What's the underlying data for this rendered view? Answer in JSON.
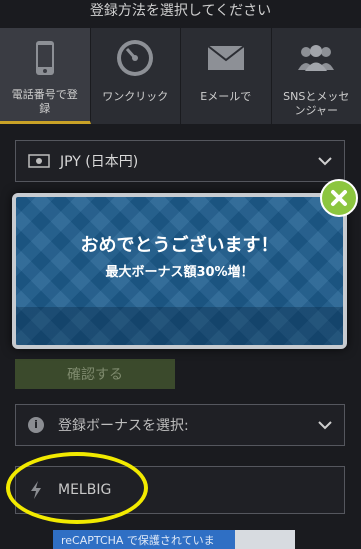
{
  "header": {
    "title": "登録方法を選択してください"
  },
  "tabs": [
    {
      "label": "電話番号で登\n録",
      "icon": "phone-icon",
      "active": true
    },
    {
      "label": "ワンクリック",
      "icon": "speedometer-icon",
      "active": false
    },
    {
      "label": "Eメールで",
      "icon": "envelope-icon",
      "active": false
    },
    {
      "label": "SNSとメッセ\nンジャー",
      "icon": "users-icon",
      "active": false
    }
  ],
  "currency": {
    "value": "JPY (日本円)",
    "icon": "banknote-icon"
  },
  "modal": {
    "title": "おめでとうございます！",
    "subtitle": "最大ボーナス額30%増！"
  },
  "confirm": {
    "label": "確認する"
  },
  "bonus": {
    "label": "登録ボーナスを選択:"
  },
  "promo": {
    "value": "MELBIG",
    "icon": "lightning-icon"
  },
  "recaptcha": {
    "text": "reCAPTCHA で保護されていま"
  },
  "colors": {
    "accent_green": "#8cc63f",
    "modal_blue": "#1d5d8e",
    "highlight_yellow": "#f2ea00",
    "active_tab_underline": "#c9a227"
  }
}
